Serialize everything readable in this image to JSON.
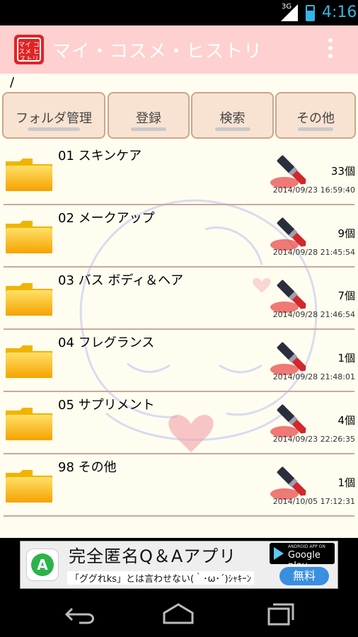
{
  "status_bar": {
    "signal_label": "3G",
    "time": "4:16"
  },
  "app_bar": {
    "icon_text": "マイ コスメ ヒストリ",
    "title": "マイ・コスメ・ヒストリ"
  },
  "path": "/",
  "tabs": [
    {
      "label": "フォルダ管理"
    },
    {
      "label": "登録"
    },
    {
      "label": "検索"
    },
    {
      "label": "その他"
    }
  ],
  "folders": [
    {
      "name": "01 スキンケア",
      "count": "33個",
      "date": "2014/09/23 16:59:40"
    },
    {
      "name": "02 メークアップ",
      "count": "9個",
      "date": "2014/09/28 21:45:54"
    },
    {
      "name": "03 バス ボディ＆ヘア",
      "count": "7個",
      "date": "2014/09/28 21:46:54"
    },
    {
      "name": "04 フレグランス",
      "count": "1個",
      "date": "2014/09/28 21:48:01"
    },
    {
      "name": "05 サプリメント",
      "count": "4個",
      "date": "2014/09/23 22:26:35"
    },
    {
      "name": "98 その他",
      "count": "1個",
      "date": "2014/10/05 17:12:31"
    }
  ],
  "ad": {
    "logo_letter": "A",
    "title": "完全匿名Q＆Aアプリ",
    "subtitle": "「ググれks」とは言わせない(｀･ω･´)ｼｬｷｰﾝ",
    "gplay_small": "ANDROID APP ON",
    "gplay_big": "Google play",
    "free_label": "無料"
  },
  "colors": {
    "action_bar": "#ffd0d0",
    "content_bg": "#fffdf0",
    "tab_bg": "#f8e3d3",
    "accent_blue": "#33b5e5"
  }
}
